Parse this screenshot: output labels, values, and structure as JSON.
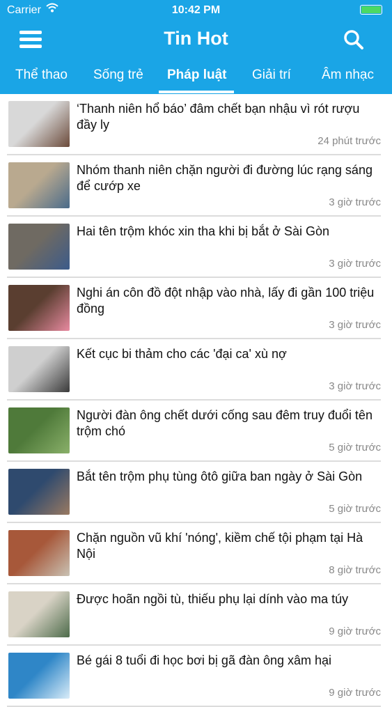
{
  "status_bar": {
    "carrier": "Carrier",
    "time": "10:42 PM",
    "battery_level": 1.0
  },
  "header": {
    "title": "Tin Hot",
    "menu_icon": "hamburger-icon",
    "search_icon": "search-icon"
  },
  "tabs": [
    {
      "label": "Thể thao",
      "active": false
    },
    {
      "label": "Sống trẻ",
      "active": false
    },
    {
      "label": "Pháp luật",
      "active": true
    },
    {
      "label": "Giải trí",
      "active": false
    },
    {
      "label": "Âm nhạc",
      "active": false
    }
  ],
  "articles": [
    {
      "headline": "‘Thanh niên hổ báo’ đâm chết bạn nhậu vì rót rượu đầy ly",
      "time": "24 phút trước",
      "thumb_colors": [
        "#d8d8d8",
        "#6b4a3a"
      ]
    },
    {
      "headline": "Nhóm thanh niên chặn người đi đường lúc rạng sáng để cướp xe",
      "time": "3 giờ trước",
      "thumb_colors": [
        "#b9a98f",
        "#4a6b8a"
      ]
    },
    {
      "headline": "Hai tên trộm khóc xin tha khi bị bắt ở Sài Gòn",
      "time": "3 giờ trước",
      "thumb_colors": [
        "#6f6a62",
        "#3c5b8a"
      ]
    },
    {
      "headline": "Nghi án côn đồ đột nhập vào nhà, lấy đi gần 100 triệu đồng",
      "time": "3 giờ trước",
      "thumb_colors": [
        "#5a3e30",
        "#e88aa0"
      ]
    },
    {
      "headline": "Kết cục bi thảm cho các 'đại ca' xù nợ",
      "time": "3 giờ trước",
      "thumb_colors": [
        "#cfcfcf",
        "#3a3a3a"
      ]
    },
    {
      "headline": "Người đàn ông chết dưới cống sau đêm truy đuổi tên trộm chó",
      "time": "5 giờ trước",
      "thumb_colors": [
        "#4f7a3a",
        "#8ab06a"
      ]
    },
    {
      "headline": "Bắt tên trộm phụ tùng ôtô giữa ban ngày ở Sài Gòn",
      "time": "5 giờ trước",
      "thumb_colors": [
        "#2f4a6e",
        "#9a7a62"
      ]
    },
    {
      "headline": "Chặn nguồn vũ khí 'nóng', kiềm chế tội phạm tại Hà Nội",
      "time": "8 giờ trước",
      "thumb_colors": [
        "#a7583a",
        "#c9c2b4"
      ]
    },
    {
      "headline": "Được hoãn ngồi tù, thiếu phụ lại dính vào ma túy",
      "time": "9 giờ trước",
      "thumb_colors": [
        "#d9d3c6",
        "#4d6b4a"
      ]
    },
    {
      "headline": "Bé gái 8 tuổi đi học bơi bị gã đàn ông xâm hại",
      "time": "9 giờ trước",
      "thumb_colors": [
        "#2f86c7",
        "#d9ecf8"
      ]
    }
  ],
  "colors": {
    "header_bg": "#1aa5e6",
    "divider": "#dcdcdc",
    "time_text": "#888888"
  }
}
